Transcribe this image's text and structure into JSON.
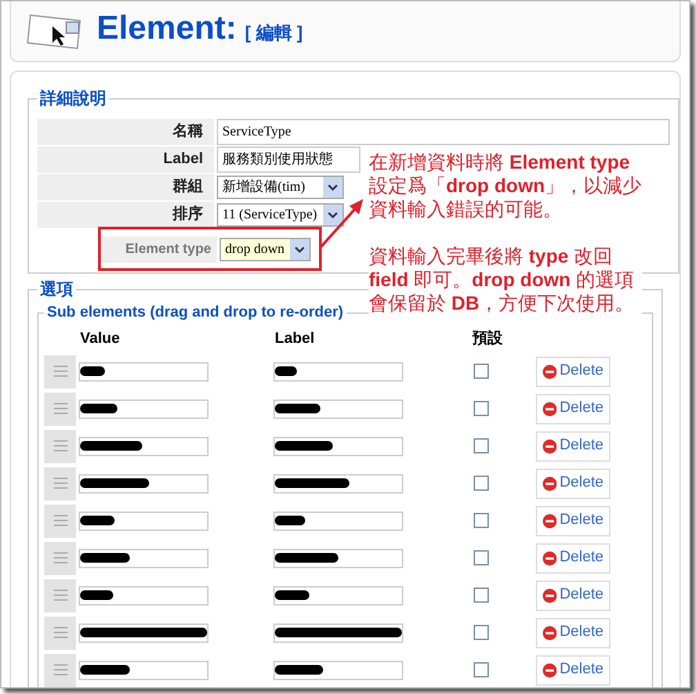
{
  "header": {
    "title": "Element:",
    "edit_link": "[ 編輯 ]"
  },
  "details": {
    "legend": "詳細說明",
    "fields": [
      {
        "kind": "text",
        "label": "名稱",
        "value": "ServiceType"
      },
      {
        "kind": "text",
        "label": "Label",
        "value": "服務類別使用狀態"
      },
      {
        "kind": "select",
        "label": "群組",
        "value": "新增設備(tim)"
      },
      {
        "kind": "select",
        "label": "排序",
        "value": "11 (ServiceType)"
      },
      {
        "kind": "select",
        "label": "Element type",
        "value": "drop down",
        "highlighted": true
      }
    ]
  },
  "annotation": {
    "paragraphs": [
      [
        "在新增資料時將 **Element type**",
        "設定爲「**drop down**」，以減少",
        "資料輸入錯誤的可能。"
      ],
      [
        "資料輸入完畢後將 **type** 改回",
        "**field** 即可。**drop down** 的選項",
        "會保留於 **DB**，方便下次使用。"
      ]
    ]
  },
  "options": {
    "legend": "選項",
    "sub_legend": "Sub elements (drag and drop to re-order)",
    "columns": [
      "Value",
      "Label",
      "預設"
    ],
    "rows": [
      {
        "value_redacted": true,
        "label_redacted": true,
        "default": false,
        "delete": "Delete"
      },
      {
        "value_redacted": true,
        "label_redacted": true,
        "default": false,
        "delete": "Delete"
      },
      {
        "value_redacted": true,
        "label_redacted": true,
        "default": false,
        "delete": "Delete"
      },
      {
        "value_redacted": true,
        "label_redacted": true,
        "default": false,
        "delete": "Delete"
      },
      {
        "value_redacted": true,
        "label_redacted": true,
        "default": false,
        "delete": "Delete"
      },
      {
        "value_redacted": true,
        "label_redacted": true,
        "default": false,
        "delete": "Delete"
      },
      {
        "value_redacted": true,
        "label_redacted": true,
        "default": false,
        "delete": "Delete"
      },
      {
        "value_redacted": true,
        "label_redacted": true,
        "default": false,
        "delete": "Delete"
      },
      {
        "value_redacted": true,
        "label_redacted": true,
        "default": false,
        "delete": "Delete"
      }
    ]
  }
}
